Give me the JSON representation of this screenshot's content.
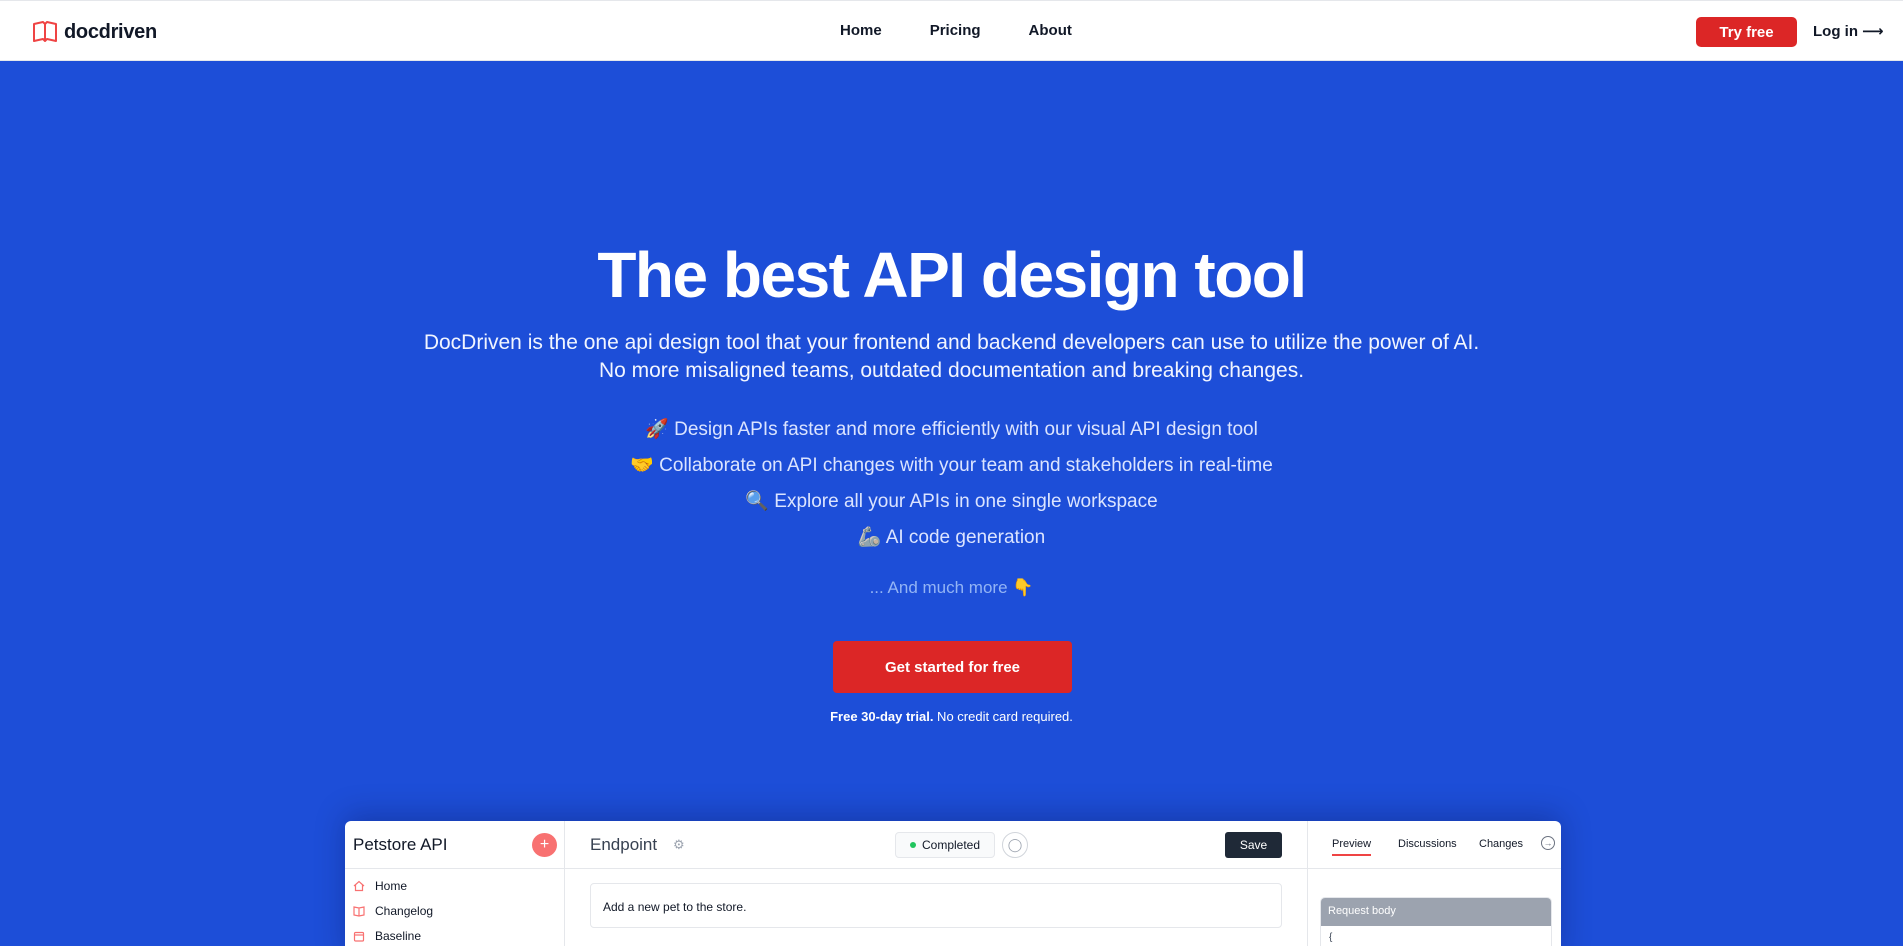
{
  "nav": {
    "brand": "docdriven",
    "links": [
      "Home",
      "Pricing",
      "About"
    ],
    "try_free": "Try free",
    "login": "Log in"
  },
  "hero": {
    "title": "The best API design tool",
    "subtitle_line1": "DocDriven is the one api design tool that your frontend and backend developers can use to utilize the power of AI.",
    "subtitle_line2": "No more misaligned teams, outdated documentation and breaking changes.",
    "features": [
      {
        "emoji": "🚀",
        "text": "Design APIs faster and more efficiently with our visual API design tool"
      },
      {
        "emoji": "🤝",
        "text": "Collaborate on API changes with your team and stakeholders in real-time"
      },
      {
        "emoji": "🔍",
        "text": "Explore all your APIs in one single workspace"
      },
      {
        "emoji": "🦾",
        "text": "AI code generation"
      }
    ],
    "more": "... And much more 👇",
    "cta": "Get started for free",
    "trial_bold": "Free 30-day trial.",
    "trial_rest": " No credit card required."
  },
  "app_preview": {
    "project_title": "Petstore API",
    "add_icon": "+",
    "sidebar": [
      "Home",
      "Changelog",
      "Baseline"
    ],
    "endpoint_title": "Endpoint",
    "status": "Completed",
    "save": "Save",
    "description": "Add a new pet to the store.",
    "right_tabs": [
      "Preview",
      "Discussions",
      "Changes"
    ],
    "request_body_label": "Request body",
    "request_body_start": "{"
  },
  "colors": {
    "hero_bg": "#1d4ed8",
    "accent_red": "#dc2626"
  }
}
